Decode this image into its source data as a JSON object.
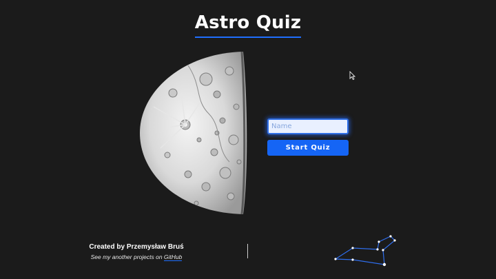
{
  "header": {
    "title": "Astro Quiz"
  },
  "form": {
    "name_placeholder": "Name",
    "name_value": "",
    "start_label": "Start Quiz"
  },
  "footer": {
    "credit": "Created by Przemysław Bruś",
    "subline_prefix": "See my another projects on ",
    "github_link": "GitHub"
  },
  "colors": {
    "background": "#1b1b1b",
    "accent": "#1565f5",
    "input_bg": "#e9f0ff"
  },
  "icons": [
    "moon-illustration",
    "mouse-cursor-icon",
    "constellation-illustration"
  ]
}
